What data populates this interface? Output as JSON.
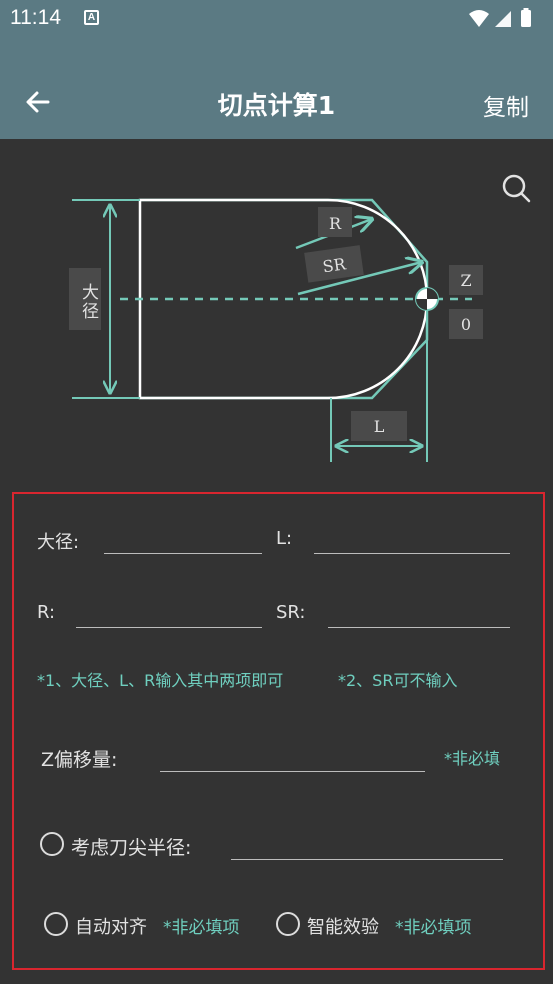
{
  "status_bar": {
    "time": "11:14",
    "notification_icon": "A"
  },
  "app_bar": {
    "title": "切点计算1",
    "action_label": "复制"
  },
  "diagram": {
    "label_diameter": "大径",
    "label_r": "R",
    "label_sr": "SR",
    "label_z": "Z",
    "label_zero": "0",
    "label_l": "L",
    "accent_color": "#74c9b8"
  },
  "form": {
    "diameter_label": "大径:",
    "l_label": "L:",
    "r_label": "R:",
    "sr_label": "SR:",
    "hint_1": "*1、大径、L、R输入其中两项即可",
    "hint_2": "*2、SR可不输入",
    "z_offset_label": "Z偏移量:",
    "optional_hint": "*非必填",
    "tool_nose_label": "考虑刀尖半径:",
    "auto_align_label": "自动对齐",
    "auto_align_hint": "*非必填项",
    "smart_check_label": "智能效验",
    "smart_check_hint": "*非必填项",
    "highlight_color": "#d9262f"
  }
}
